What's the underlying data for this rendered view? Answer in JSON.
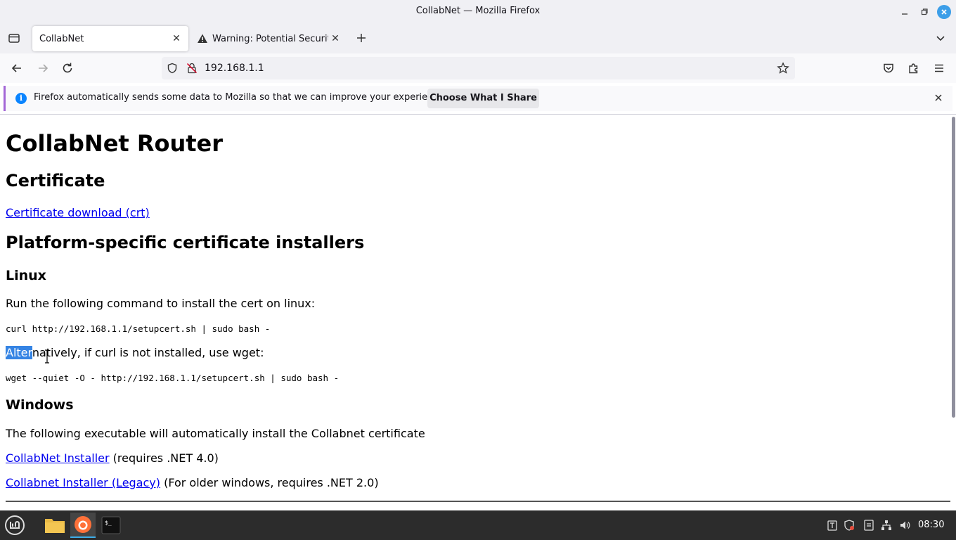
{
  "window": {
    "title": "CollabNet — Mozilla Firefox"
  },
  "tabs": [
    {
      "label": "CollabNet",
      "active": true
    },
    {
      "label": "Warning: Potential Security",
      "active": false,
      "icon": "warning-icon"
    }
  ],
  "navbar": {
    "url": "192.168.1.1"
  },
  "notification": {
    "message": "Firefox automatically sends some data to Mozilla so that we can improve your experience.",
    "button_label": "Choose What I Share"
  },
  "page": {
    "h1": "CollabNet Router",
    "certificate_heading": "Certificate",
    "certificate_link": "Certificate download (crt)",
    "installers_heading": "Platform-specific certificate installers",
    "linux_heading": "Linux",
    "linux_instruction": "Run the following command to install the cert on linux:",
    "curl_command": "curl http://192.168.1.1/setupcert.sh | sudo bash -",
    "alt_selected": "Alter",
    "alt_rest": "natively, if curl is not installed, use wget:",
    "wget_command": "wget --quiet -O - http://192.168.1.1/setupcert.sh | sudo bash -",
    "windows_heading": "Windows",
    "windows_instruction": "The following executable will automatically install the Collabnet certificate",
    "installer_link": "CollabNet Installer",
    "installer_note": " (requires .NET 4.0)",
    "legacy_link": "Collabnet Installer (Legacy)",
    "legacy_note": " (For older windows, requires .NET 2.0)"
  },
  "taskbar": {
    "clock": "08:30"
  },
  "colors": {
    "link": "#0000ee",
    "selection": "#3584e4",
    "accent": "#3daee9"
  }
}
